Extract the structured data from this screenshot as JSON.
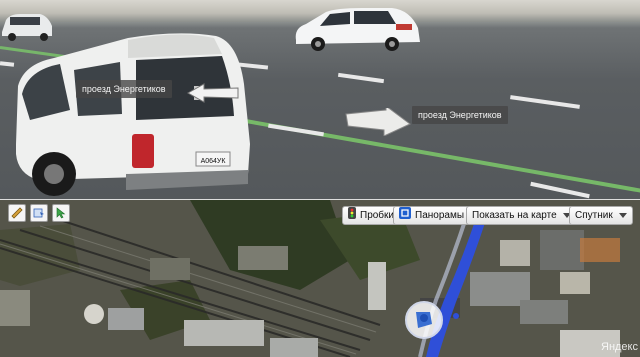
{
  "panorama": {
    "street_label_1": "проезд Энергетиков",
    "street_label_2": "проезд Энергетиков",
    "vehicle_plate": "А064УК"
  },
  "map_toolbar": {
    "ruler_icon": "ruler-icon",
    "pin_icon": "pin-icon",
    "cursor_icon": "cursor-icon"
  },
  "map_controls": {
    "traffic_label": "Пробки",
    "panoramas_label": "Панорамы",
    "show_on_map_label": "Показать на карте",
    "layer_label": "Спутник"
  },
  "map": {
    "copyright": "Яндекс"
  },
  "colors": {
    "road_blue": "#2f4fd8",
    "lane_green": "#7cc96a",
    "panoramas_icon_blue": "#1f5fcf",
    "traffic_icon_bg": "#444444"
  }
}
